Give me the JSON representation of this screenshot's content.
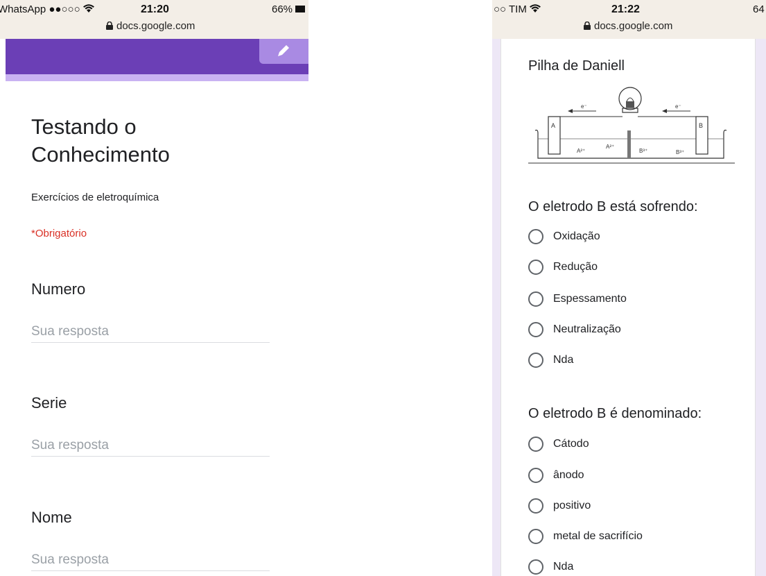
{
  "left": {
    "status": {
      "carrier": "WhatsApp",
      "signal": "●●○○○",
      "time": "21:20",
      "battery": "66%",
      "url": "docs.google.com"
    },
    "header": {
      "edit_icon": "pencil-icon",
      "color": "#6b3fb6"
    },
    "form": {
      "title": "Testando o Conhecimento",
      "description": "Exercícios de eletroquímica",
      "required_note": "*Obrigatório",
      "questions": [
        {
          "label": "Numero",
          "placeholder": "Sua resposta"
        },
        {
          "label": "Serie",
          "placeholder": "Sua resposta"
        },
        {
          "label": "Nome",
          "placeholder": "Sua resposta"
        }
      ]
    }
  },
  "right": {
    "status": {
      "carrier": "○○ TIM",
      "time": "21:22",
      "battery": "64",
      "url": "docs.google.com"
    },
    "image_title": "Pilha de Daniell",
    "diagram": {
      "electron_label": "e⁻",
      "electrode_a": "A",
      "electrode_b": "B",
      "ion_a": "A²⁺",
      "ion_b": "B³⁺"
    },
    "questions": [
      {
        "label": "O eletrodo B está sofrendo:",
        "options": [
          "Oxidação",
          "Redução",
          "Espessamento",
          "Neutralização",
          "Nda"
        ]
      },
      {
        "label": "O eletrodo B é denominado:",
        "options": [
          "Cátodo",
          "ânodo",
          "positivo",
          "metal de sacrifício",
          "Nda"
        ]
      }
    ]
  }
}
